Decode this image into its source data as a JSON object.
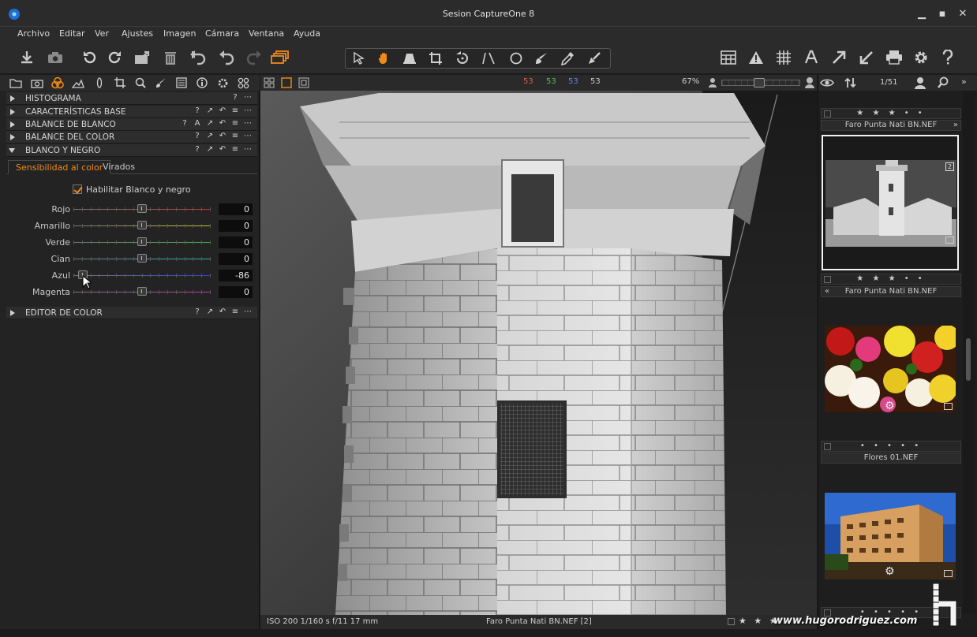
{
  "window": {
    "title": "Sesion CaptureOne 8"
  },
  "menu": [
    "Archivo",
    "Editar",
    "Ver",
    "Ajustes",
    "Imagen",
    "Cámara",
    "Ventana",
    "Ayuda"
  ],
  "toolbar": {
    "left_icons": [
      "import-icon",
      "camera-icon",
      "rotate-left-icon",
      "rotate-right-icon",
      "export-icon",
      "trash-icon",
      "undo-icon",
      "undo-alt-icon",
      "redo-icon",
      "layers-icon"
    ],
    "cursor_tools": [
      "pointer-icon",
      "pan-icon",
      "keystone-icon",
      "crop-icon",
      "rotate-tool-icon",
      "straighten-icon",
      "circle-icon",
      "brush-icon",
      "picker-icon",
      "adjust-picker-icon"
    ],
    "right_icons": [
      "grid-icon",
      "warning-icon",
      "overlay-icon",
      "text-icon",
      "arrow-up-icon",
      "arrow-down-icon",
      "print-icon",
      "gear-icon",
      "help-icon"
    ]
  },
  "left_panel": {
    "sections": [
      {
        "label": "HISTOGRAMA",
        "ctrls": [
          "?",
          "⋯"
        ]
      },
      {
        "label": "CARACTERÍSTICAS BASE",
        "ctrls": [
          "?",
          "↗",
          "↶",
          "≡",
          "⋯"
        ]
      },
      {
        "label": "BALANCE DE BLANCO",
        "ctrls": [
          "?",
          "A",
          "↗",
          "↶",
          "≡",
          "⋯"
        ]
      },
      {
        "label": "BALANCE DEL COLOR",
        "ctrls": [
          "?",
          "↗",
          "↶",
          "≡",
          "⋯"
        ]
      },
      {
        "label": "BLANCO Y NEGRO",
        "ctrls": [
          "?",
          "↗",
          "↶",
          "≡",
          "⋯"
        ]
      },
      {
        "label": "EDITOR DE COLOR",
        "ctrls": [
          "?",
          "↗",
          "↶",
          "≡",
          "⋯"
        ]
      }
    ],
    "bw": {
      "tabs": [
        "Sensibilidad al color",
        "Virados"
      ],
      "enable_label": "Habilitar Blanco y negro",
      "sliders": [
        {
          "name": "Rojo",
          "value": 0,
          "color": "#c0392b"
        },
        {
          "name": "Amarillo",
          "value": 0,
          "color": "#c9c02a"
        },
        {
          "name": "Verde",
          "value": 0,
          "color": "#3cb043"
        },
        {
          "name": "Cian",
          "value": 0,
          "color": "#2ab3b3"
        },
        {
          "name": "Azul",
          "value": -86,
          "color": "#3a3acf"
        },
        {
          "name": "Magenta",
          "value": 0,
          "color": "#b23ab2"
        }
      ]
    }
  },
  "viewer": {
    "readouts": {
      "r": "53",
      "g": "53",
      "b": "53",
      "l": "53"
    },
    "zoom": "67%",
    "counter": "1/51",
    "status_left": "ISO 200  1/160 s  f/11  17 mm",
    "status_center": "Faro Punta Nati BN.NEF [2]"
  },
  "browser": {
    "items": [
      {
        "name": "Faro Punta Nati BN.NEF",
        "rating": "★ ★ ★ • •",
        "badge": "2"
      },
      {
        "name": "Faro Punta Nati BN.NEF",
        "rating": "★ ★ ★ • •"
      },
      {
        "name": "Flores 01.NEF",
        "rating": "• • • • •"
      },
      {
        "name": "",
        "rating": "• • • • •"
      }
    ]
  },
  "watermark": "www.hugorodriguez.com"
}
